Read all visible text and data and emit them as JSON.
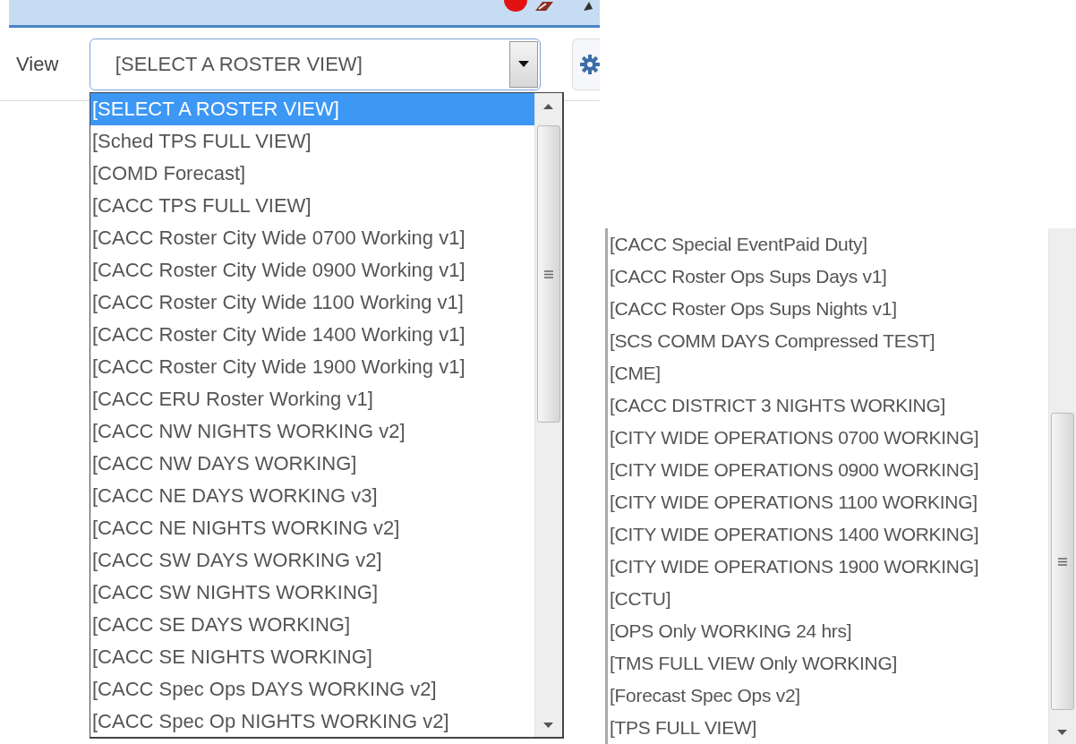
{
  "toolbar": {
    "label": "View",
    "select_value": "[SELECT A ROSTER VIEW]"
  },
  "dropdown": {
    "options": [
      {
        "label": "[SELECT A ROSTER VIEW]",
        "selected": true
      },
      {
        "label": "[Sched TPS FULL VIEW]",
        "selected": false
      },
      {
        "label": "[COMD Forecast]",
        "selected": false
      },
      {
        "label": "[CACC TPS FULL VIEW]",
        "selected": false
      },
      {
        "label": "[CACC Roster City Wide 0700 Working v1]",
        "selected": false
      },
      {
        "label": "[CACC Roster City Wide 0900 Working v1]",
        "selected": false
      },
      {
        "label": "[CACC Roster City Wide 1100 Working v1]",
        "selected": false
      },
      {
        "label": "[CACC Roster City Wide 1400 Working v1]",
        "selected": false
      },
      {
        "label": "[CACC Roster City Wide 1900 Working v1]",
        "selected": false
      },
      {
        "label": "[CACC ERU Roster Working v1]",
        "selected": false
      },
      {
        "label": "[CACC NW NIGHTS WORKING v2]",
        "selected": false
      },
      {
        "label": "[CACC NW DAYS WORKING]",
        "selected": false
      },
      {
        "label": "[CACC NE DAYS WORKING v3]",
        "selected": false
      },
      {
        "label": "[CACC NE NIGHTS WORKING v2]",
        "selected": false
      },
      {
        "label": "[CACC SW DAYS WORKING v2]",
        "selected": false
      },
      {
        "label": "[CACC SW NIGHTS WORKING]",
        "selected": false
      },
      {
        "label": "[CACC SE DAYS WORKING]",
        "selected": false
      },
      {
        "label": "[CACC SE NIGHTS WORKING]",
        "selected": false
      },
      {
        "label": "[CACC Spec Ops DAYS WORKING v2]",
        "selected": false
      },
      {
        "label": "[CACC Spec Op NIGHTS WORKING v2]",
        "selected": false
      }
    ]
  },
  "second_list": {
    "options": [
      {
        "label": "[CACC Special EventPaid Duty]",
        "selected": false
      },
      {
        "label": "[CACC Roster Ops Sups Days v1]",
        "selected": false
      },
      {
        "label": "[CACC Roster Ops Sups Nights v1]",
        "selected": false
      },
      {
        "label": "[SCS COMM DAYS Compressed TEST]",
        "selected": false
      },
      {
        "label": "[CME]",
        "selected": false
      },
      {
        "label": "[CACC DISTRICT 3 NIGHTS WORKING]",
        "selected": false
      },
      {
        "label": "[CITY WIDE OPERATIONS 0700 WORKING]",
        "selected": false
      },
      {
        "label": "[CITY WIDE OPERATIONS 0900 WORKING]",
        "selected": false
      },
      {
        "label": "[CITY WIDE OPERATIONS 1100 WORKING]",
        "selected": false
      },
      {
        "label": "[CITY WIDE OPERATIONS 1400 WORKING]",
        "selected": false
      },
      {
        "label": "[CITY WIDE OPERATIONS 1900 WORKING]",
        "selected": false
      },
      {
        "label": "[CCTU]",
        "selected": false
      },
      {
        "label": "[OPS Only WORKING 24 hrs]",
        "selected": false
      },
      {
        "label": "[TMS FULL VIEW Only WORKING]",
        "selected": false
      },
      {
        "label": "[Forecast Spec Ops v2]",
        "selected": false
      },
      {
        "label": "[TPS FULL VIEW]",
        "selected": false
      }
    ]
  }
}
